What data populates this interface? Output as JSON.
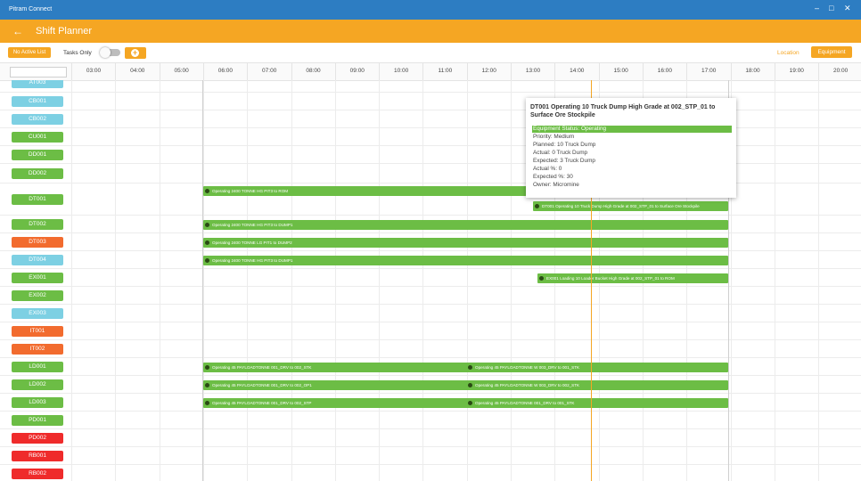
{
  "window": {
    "title": "Pitram Connect",
    "controls": [
      "–",
      "□",
      "✕"
    ]
  },
  "appbar": {
    "back_icon": "arrow-left-icon",
    "title": "Shift Planner"
  },
  "toolbar": {
    "no_active_list": "No Active List",
    "tasks_only": "Tasks Only",
    "tasks_only_on": false,
    "add_icon": "plus-circle-icon",
    "location_tab": "Location",
    "equipment_tab": "Equipment"
  },
  "timeline": {
    "hours": [
      "03:00",
      "04:00",
      "05:00",
      "06:00",
      "07:00",
      "08:00",
      "09:00",
      "10:00",
      "11:00",
      "12:00",
      "13:00",
      "14:00",
      "15:00",
      "16:00",
      "17:00",
      "18:00",
      "19:00",
      "20:00"
    ]
  },
  "colors": {
    "accent": "#f5a623",
    "titlebar": "#2d7dc2",
    "bar": "#6cbd45",
    "light_blue": "#7dd0e3",
    "green": "#6cbd45",
    "orange": "#f26b2e",
    "red": "#ef2b2b"
  },
  "equipment": [
    {
      "id": "AT003",
      "color": "#7dd0e3"
    },
    {
      "id": "CB001",
      "color": "#7dd0e3"
    },
    {
      "id": "CB002",
      "color": "#7dd0e3"
    },
    {
      "id": "CU001",
      "color": "#6cbd45"
    },
    {
      "id": "DD001",
      "color": "#6cbd45"
    },
    {
      "id": "DD002",
      "color": "#6cbd45"
    },
    {
      "id": "DT001",
      "color": "#6cbd45"
    },
    {
      "id": "DT002",
      "color": "#6cbd45"
    },
    {
      "id": "DT003",
      "color": "#f26b2e"
    },
    {
      "id": "DT004",
      "color": "#7dd0e3"
    },
    {
      "id": "EX001",
      "color": "#6cbd45"
    },
    {
      "id": "EX002",
      "color": "#6cbd45"
    },
    {
      "id": "EX003",
      "color": "#7dd0e3"
    },
    {
      "id": "IT001",
      "color": "#f26b2e"
    },
    {
      "id": "IT002",
      "color": "#f26b2e"
    },
    {
      "id": "LD001",
      "color": "#6cbd45"
    },
    {
      "id": "LD002",
      "color": "#6cbd45"
    },
    {
      "id": "LD003",
      "color": "#6cbd45"
    },
    {
      "id": "PD001",
      "color": "#6cbd45"
    },
    {
      "id": "PD002",
      "color": "#ef2b2b"
    },
    {
      "id": "RB001",
      "color": "#ef2b2b"
    },
    {
      "id": "RB002",
      "color": "#ef2b2b"
    }
  ],
  "tasks": {
    "dt001_a": "Operating 2400 TONNE HG PIT3 to ROM",
    "dt001_b": "DT001 Operating 10 Truck Dump High Grade at 002_STP_01 to Surface Ore Stockpile",
    "dt002": "Operating 2400 TONNE HG PIT3 to DUMP1",
    "dt003": "Operating 2400 TONNE LG PIT1 to DUMP2",
    "dt004": "Operating 2400 TONNE HG PIT3 to DUMP1",
    "ex001": "EX001 Loading 10 Loader Bucket High Grade at 002_STP_01 to ROM",
    "ld001_a": "Operating 45 PAYLOADTONNE 001_DRV to 002_STK",
    "ld001_b": "Operating 45 PAYLOADTONNE W 003_DRV to 001_STK",
    "ld002_a": "Operating 45 PAYLOADTONNE 001_DRV to 002_OP1",
    "ld002_b": "Operating 45 PAYLOADTONNE W 003_DRV to 002_STK",
    "ld003_a": "Operating 45 PAYLOADTONNE 001_DRV to 002_STP",
    "ld003_b": "Operating 45 PAYLOADTONNE 001_DRV to 001_STK"
  },
  "tooltip": {
    "title": "DT001 Operating 10 Truck Dump High Grade at 002_STP_01 to Surface Ore Stockpile",
    "status": "Equipment Status: Operating",
    "priority": "Priority: Medium",
    "planned": "Planned: 10 Truck Dump",
    "actual": "Actual: 0 Truck Dump",
    "expected": "Expected: 3 Truck Dump",
    "actual_pct": "Actual %: 0",
    "expected_pct": "Expected %: 30",
    "owner": "Owner: Micromine"
  }
}
